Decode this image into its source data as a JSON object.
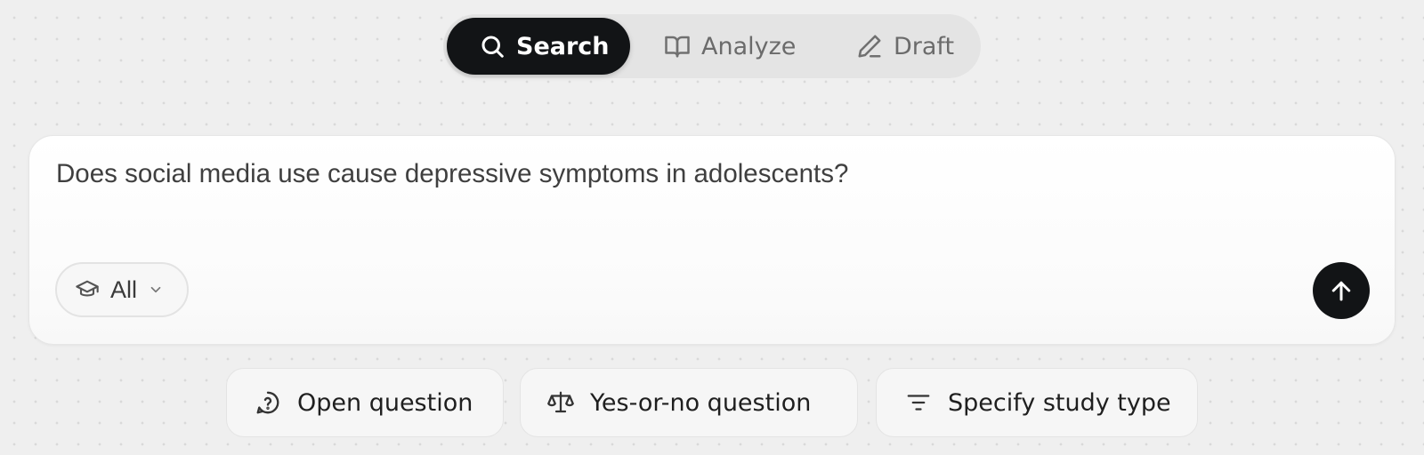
{
  "mode_tabs": [
    {
      "label": "Search",
      "icon": "search-icon",
      "active": true
    },
    {
      "label": "Analyze",
      "icon": "book-open-icon",
      "active": false
    },
    {
      "label": "Draft",
      "icon": "pencil-icon",
      "active": false
    }
  ],
  "query": {
    "text": "Does social media use cause depressive symptoms in adolescents?",
    "filter": {
      "label": "All",
      "icon": "graduation-cap-icon"
    },
    "submit_icon": "arrow-up-icon"
  },
  "suggestions": [
    {
      "label": "Open question",
      "icon": "help-circle-icon"
    },
    {
      "label": "Yes-or-no question",
      "icon": "scale-icon"
    },
    {
      "label": "Specify study type",
      "icon": "filter-lines-icon"
    }
  ],
  "colors": {
    "background": "#efefef",
    "accent_dark": "#121416",
    "tab_track": "#e4e4e4",
    "inactive_text": "#6b6b6b"
  }
}
